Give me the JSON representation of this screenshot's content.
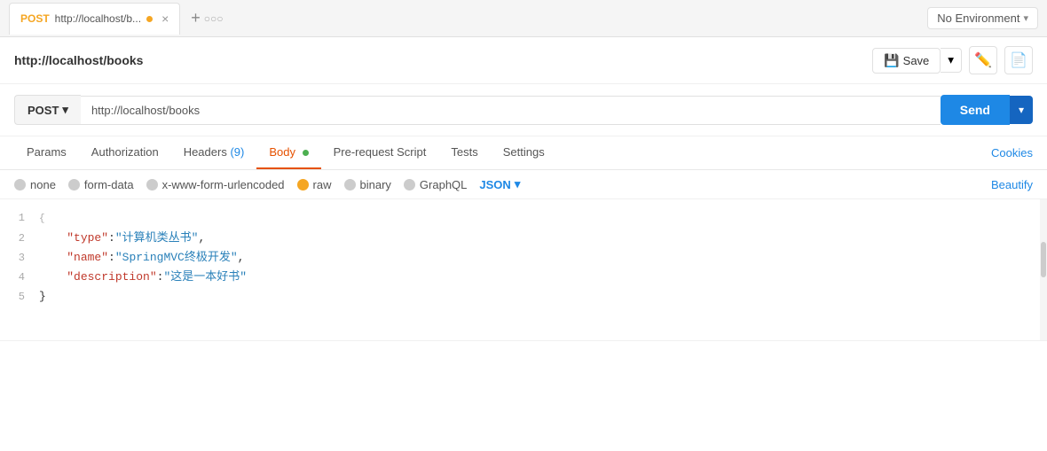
{
  "tab": {
    "method": "POST",
    "url": "http://localhost/b...",
    "dot_color": "#f5a623"
  },
  "env": {
    "label": "No Environment"
  },
  "request": {
    "title": "http://localhost/books",
    "save_label": "Save"
  },
  "url_bar": {
    "method": "POST",
    "url": "http://localhost/books",
    "send_label": "Send"
  },
  "nav_tabs": [
    {
      "id": "params",
      "label": "Params",
      "active": false
    },
    {
      "id": "authorization",
      "label": "Authorization",
      "active": false
    },
    {
      "id": "headers",
      "label": "Headers",
      "badge": "(9)",
      "active": false
    },
    {
      "id": "body",
      "label": "Body",
      "active": true,
      "dot": true
    },
    {
      "id": "pre-request",
      "label": "Pre-request Script",
      "active": false
    },
    {
      "id": "tests",
      "label": "Tests",
      "active": false
    },
    {
      "id": "settings",
      "label": "Settings",
      "active": false
    }
  ],
  "cookies_label": "Cookies",
  "body_types": [
    {
      "id": "none",
      "label": "none",
      "selected": false,
      "style": "grey"
    },
    {
      "id": "form-data",
      "label": "form-data",
      "selected": false,
      "style": "grey"
    },
    {
      "id": "x-www-form-urlencoded",
      "label": "x-www-form-urlencoded",
      "selected": false,
      "style": "grey"
    },
    {
      "id": "raw",
      "label": "raw",
      "selected": true,
      "style": "orange"
    },
    {
      "id": "binary",
      "label": "binary",
      "selected": false,
      "style": "grey"
    },
    {
      "id": "graphql",
      "label": "GraphQL",
      "selected": false,
      "style": "grey"
    }
  ],
  "json_selector": "JSON",
  "beautify_label": "Beautify",
  "code_lines": [
    {
      "num": 1,
      "content": "{",
      "type": "brace"
    },
    {
      "num": 2,
      "key": "\"type\"",
      "val": "\"计算机类丛书\"",
      "comma": true
    },
    {
      "num": 3,
      "key": "\"name\"",
      "val": "\"SpringMVC终极开发\"",
      "comma": true
    },
    {
      "num": 4,
      "key": "\"description\"",
      "val": "\"这是一本好书\"",
      "comma": false
    },
    {
      "num": 5,
      "content": "}",
      "type": "brace"
    }
  ]
}
